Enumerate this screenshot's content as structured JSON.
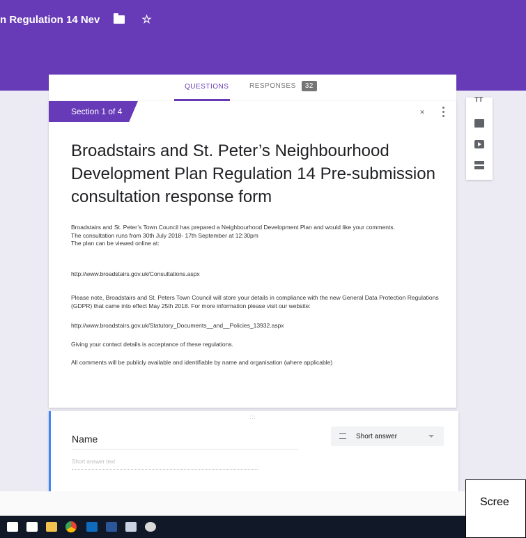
{
  "header": {
    "doc_title": "n Regulation 14 Nev"
  },
  "tabs": {
    "questions": "QUESTIONS",
    "responses": "RESPONSES",
    "responses_count": "32"
  },
  "section": {
    "tag": "Section 1 of 4",
    "title": "Broadstairs and St. Peter’s Neighbourhood Development Plan Regulation 14 Pre-submission consultation response form",
    "description": [
      "Broadstairs and St. Peter’s Town Council has prepared a Neighbourhood Development Plan and would like your comments.",
      "The consultation runs from 30th July 2018- 17th September at 12:30pm",
      "The plan can be viewed online at:",
      "http://www.broadstairs.gov.uk/Consultations.aspx",
      "Please note, Broadstairs and St. Peters Town Council will store your details in compliance with the new General Data Protection Regulations (GDPR) that came into effect May 25th 2018. For more information please visit our website:",
      "http://www.broadstairs.gov.uk/Statutory_Documents__and__Policies_13932.aspx",
      "Giving your contact details is acceptance of these regulations.",
      "All comments will be publicly available and identifiable by name and organisation (where applicable)"
    ]
  },
  "side_toolbar": {
    "title_glyph": "TT"
  },
  "question": {
    "drag_glyph": ":::",
    "title": "Name",
    "type_label": "Short answer",
    "answer_placeholder": "Short answer text"
  },
  "overlay": {
    "screen_label": "Scree"
  },
  "colors": {
    "accent": "#673ab7",
    "focus": "#4285f4",
    "background": "#eceaf3"
  },
  "icons": [
    "folder-icon",
    "star-icon",
    "collapse-icon",
    "more-vert-icon",
    "add-title-icon",
    "add-image-icon",
    "add-video-icon",
    "add-section-icon",
    "short-answer-icon",
    "dropdown-caret-icon"
  ]
}
